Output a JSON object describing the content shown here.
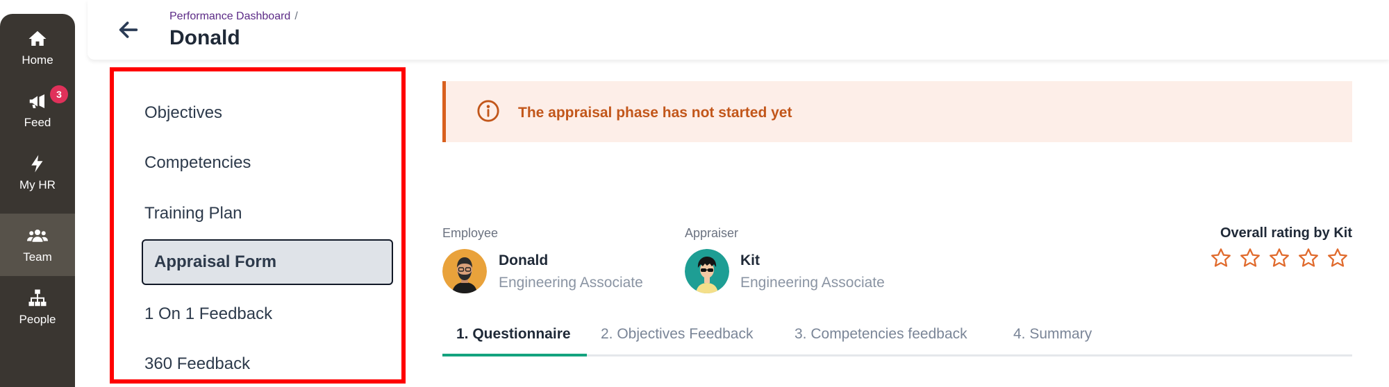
{
  "rail": {
    "items": [
      {
        "label": "Home",
        "icon": "home-icon"
      },
      {
        "label": "Feed",
        "icon": "megaphone-icon",
        "badge": "3"
      },
      {
        "label": "My HR",
        "icon": "bolt-icon"
      },
      {
        "label": "Team",
        "icon": "team-icon",
        "active": true
      },
      {
        "label": "People",
        "icon": "org-chart-icon"
      }
    ]
  },
  "header": {
    "breadcrumb": "Performance Dashboard",
    "breadcrumb_sep": "/",
    "title": "Donald"
  },
  "subnav": {
    "items": [
      {
        "label": "Objectives"
      },
      {
        "label": "Competencies"
      },
      {
        "label": "Training Plan"
      },
      {
        "label": "Appraisal Form",
        "selected": true
      },
      {
        "label": "1 On 1 Feedback"
      },
      {
        "label": "360 Feedback"
      }
    ]
  },
  "alert": {
    "icon": "info-icon",
    "text": "The appraisal phase has not started yet",
    "color": "#c2561a"
  },
  "employee": {
    "label": "Employee",
    "name": "Donald",
    "role": "Engineering Associate"
  },
  "appraiser": {
    "label": "Appraiser",
    "name": "Kit",
    "role": "Engineering Associate"
  },
  "rating": {
    "title": "Overall rating by Kit",
    "stars_total": 5,
    "stars_filled": 0,
    "star_color": "#e06a2c"
  },
  "tabs": [
    {
      "label": "1. Questionnaire",
      "active": true
    },
    {
      "label": "2. Objectives Feedback"
    },
    {
      "label": "3. Competencies feedback"
    },
    {
      "label": "4. Summary"
    }
  ],
  "colors": {
    "rail": "#3a3631",
    "accent": "#14a37f",
    "highlight_border": "#ff0000"
  }
}
